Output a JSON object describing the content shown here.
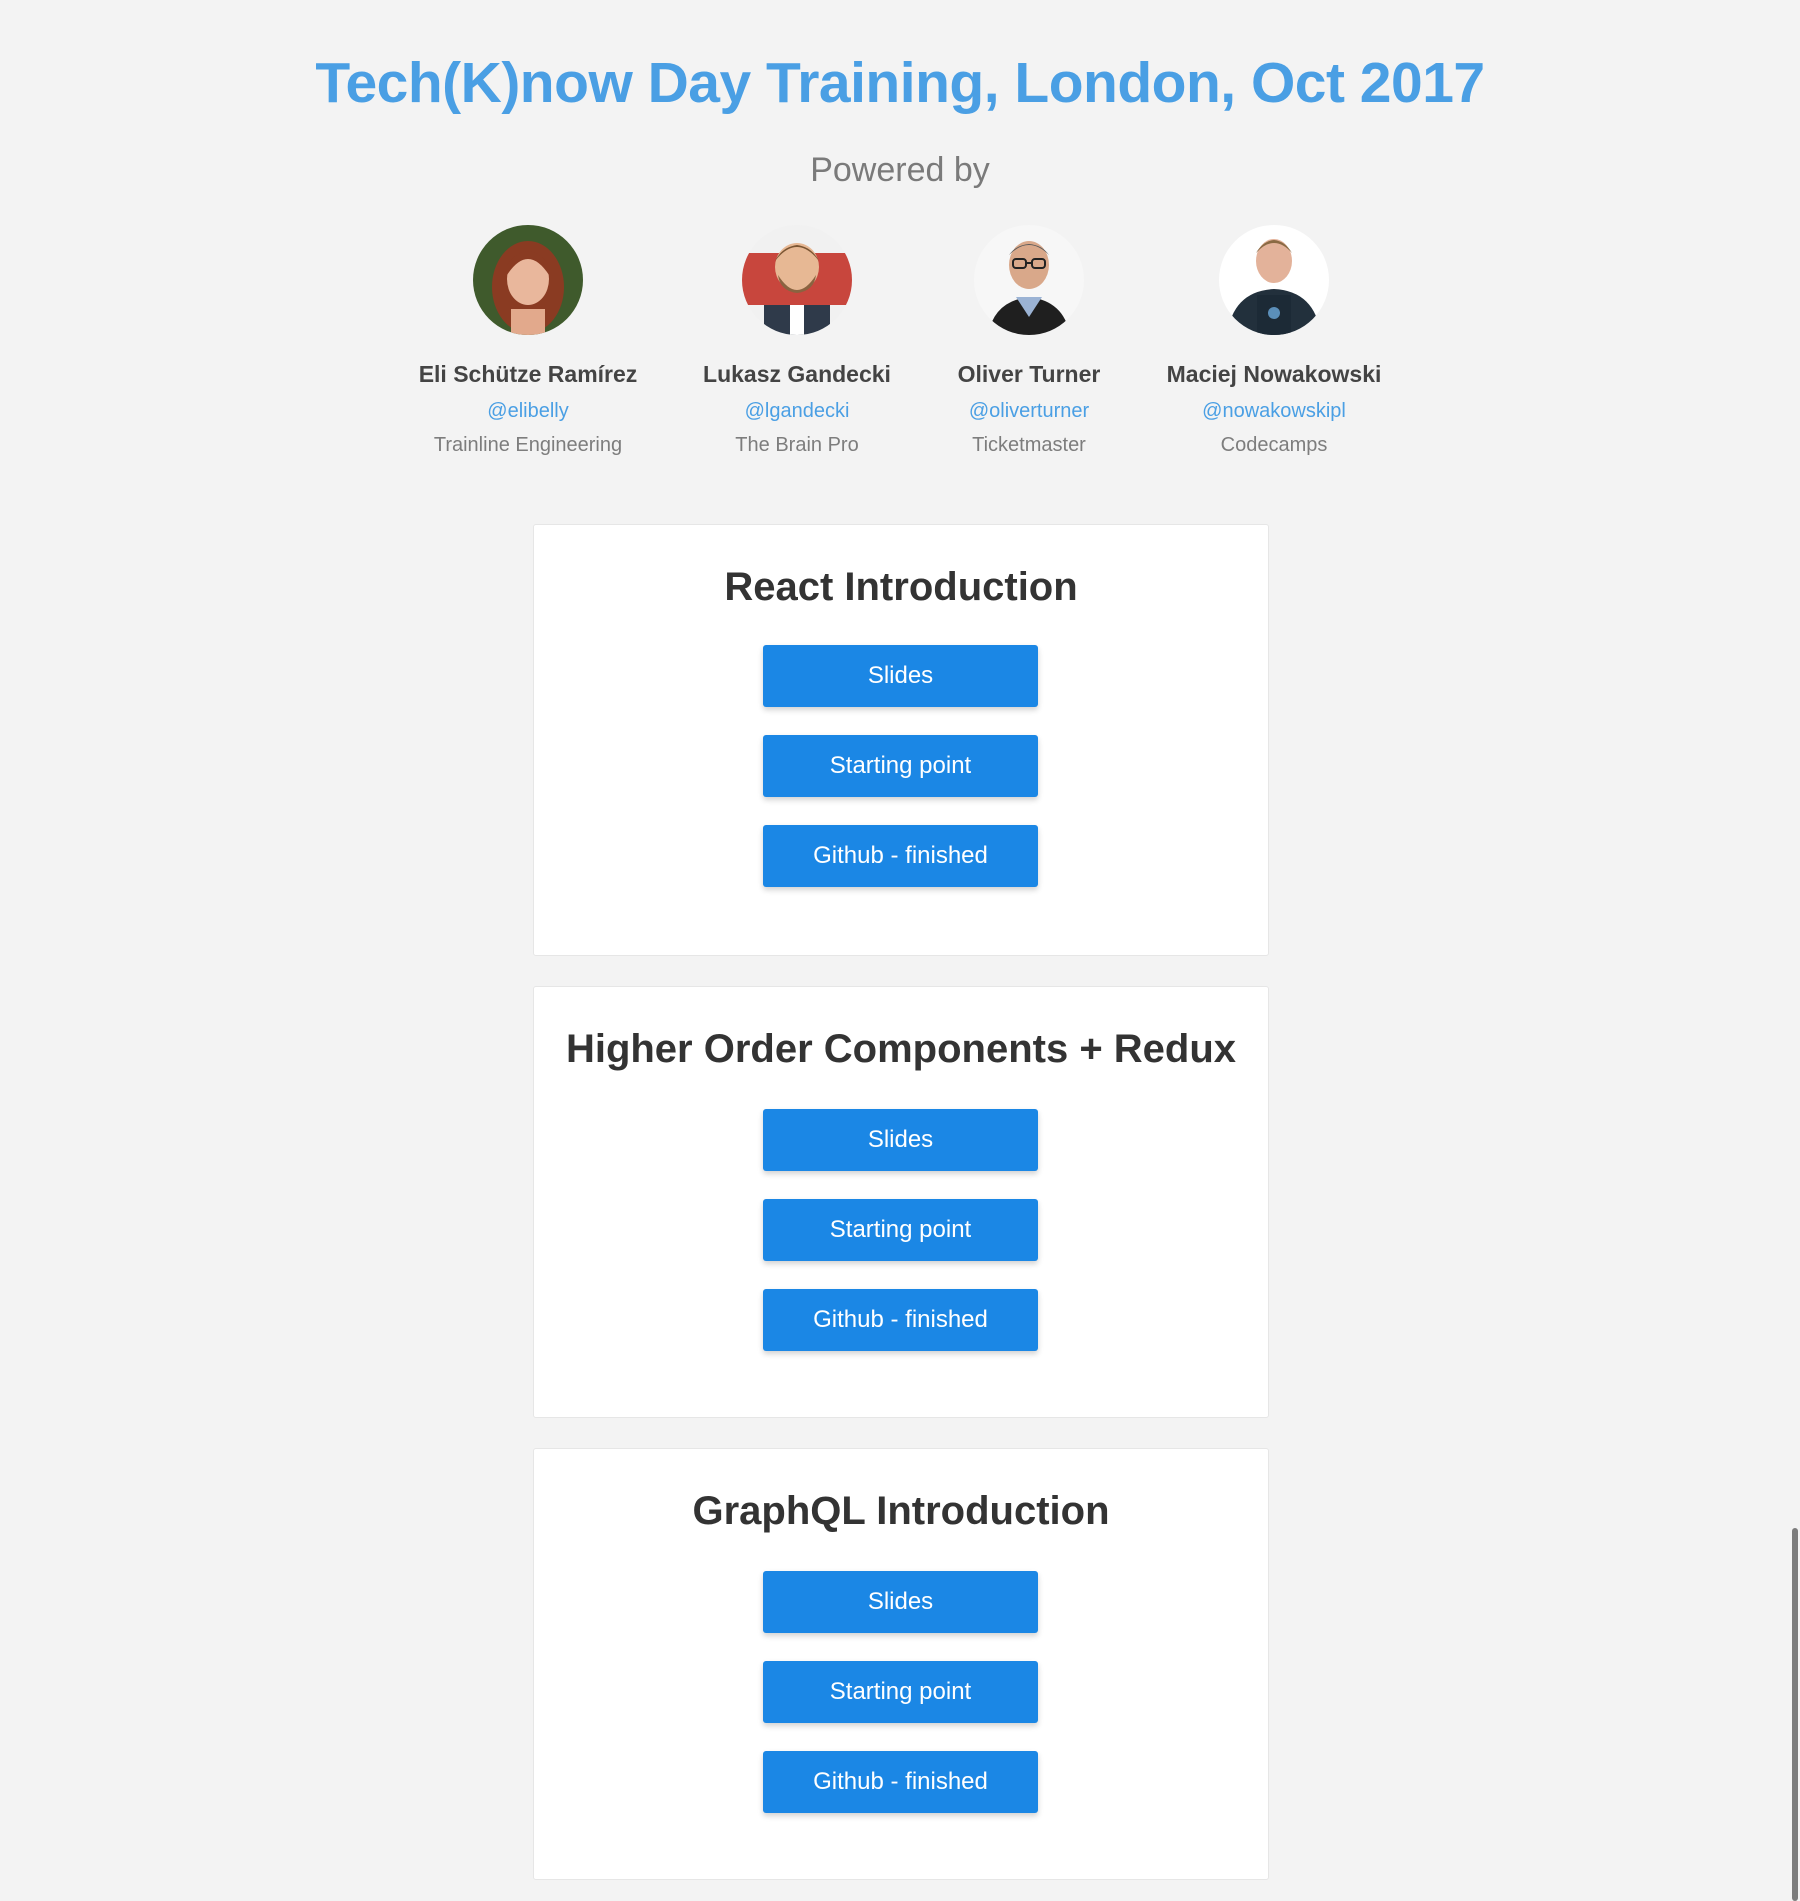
{
  "header": {
    "title": "Tech(K)now Day Training, London, Oct 2017",
    "powered_by": "Powered by"
  },
  "speakers": [
    {
      "name": "Eli Schütze Ramírez",
      "handle": "@elibelly",
      "org": "Trainline Engineering"
    },
    {
      "name": "Lukasz Gandecki",
      "handle": "@lgandecki",
      "org": "The Brain Pro"
    },
    {
      "name": "Oliver Turner",
      "handle": "@oliverturner",
      "org": "Ticketmaster"
    },
    {
      "name": "Maciej Nowakowski",
      "handle": "@nowakowskipl",
      "org": "Codecamps"
    }
  ],
  "sections": [
    {
      "title": "React Introduction",
      "buttons": [
        "Slides",
        "Starting point",
        "Github - finished"
      ]
    },
    {
      "title": "Higher Order Components + Redux",
      "buttons": [
        "Slides",
        "Starting point",
        "Github - finished"
      ]
    },
    {
      "title": "GraphQL Introduction",
      "buttons": [
        "Slides",
        "Starting point",
        "Github - finished"
      ]
    }
  ],
  "colors": {
    "accent": "#4a9fe4",
    "button": "#1b87e5",
    "background": "#f3f3f3"
  }
}
